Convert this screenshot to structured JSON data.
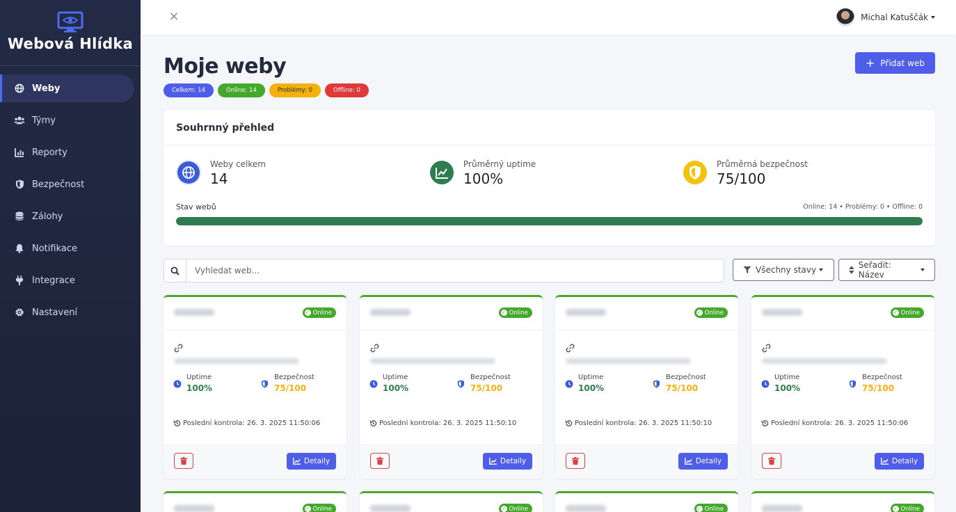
{
  "brand": {
    "name": "Webová Hlídka",
    "icon": "monitor-eye-icon"
  },
  "sidebar": {
    "items": [
      {
        "label": "Weby",
        "icon": "globe-icon",
        "active": true
      },
      {
        "label": "Týmy",
        "icon": "users-icon"
      },
      {
        "label": "Reporty",
        "icon": "chart-icon"
      },
      {
        "label": "Bezpečnost",
        "icon": "shield-icon"
      },
      {
        "label": "Zálohy",
        "icon": "database-icon"
      },
      {
        "label": "Notifikace",
        "icon": "bell-icon"
      },
      {
        "label": "Integrace",
        "icon": "plug-icon"
      },
      {
        "label": "Nastavení",
        "icon": "gear-icon"
      }
    ]
  },
  "topbar": {
    "close_icon": "×",
    "user_name": "Michal Katuščák"
  },
  "page": {
    "title": "Moje weby",
    "add_button": "Přidat web",
    "badges": {
      "total": "Celkem: 14",
      "online": "Online: 14",
      "problems": "Problémy: 0",
      "offline": "Offline: 0"
    }
  },
  "summary": {
    "title": "Souhrnný přehled",
    "stats": [
      {
        "label": "Weby celkem",
        "value": "14",
        "icon": "globe-icon",
        "color": "#3d5bd9"
      },
      {
        "label": "Průměrný uptime",
        "value": "100%",
        "icon": "chart-line-icon",
        "color": "#2e7d4f"
      },
      {
        "label": "Průměrná bezpečnost",
        "value": "75/100",
        "icon": "shield-icon",
        "color": "#f3c20c"
      }
    ],
    "status": {
      "label": "Stav webů",
      "meta": "Online: 14 • Problémy: 0 • Offline: 0",
      "online_fraction": 1.0
    }
  },
  "filters": {
    "search_placeholder": "Vyhledat web...",
    "status_filter": "Všechny stavy",
    "sort": "Seřadit: Název"
  },
  "cards": {
    "status_label": "Online",
    "uptime_label": "Uptime",
    "security_label": "Bezpečnost",
    "details_label": "Detaily",
    "items": [
      {
        "uptime": "100%",
        "security": "75/100",
        "last_check": "Poslední kontrola: 26. 3. 2025 11:50:06"
      },
      {
        "uptime": "100%",
        "security": "75/100",
        "last_check": "Poslední kontrola: 26. 3. 2025 11:50:10"
      },
      {
        "uptime": "100%",
        "security": "75/100",
        "last_check": "Poslední kontrola: 26. 3. 2025 11:50:10"
      },
      {
        "uptime": "100%",
        "security": "75/100",
        "last_check": "Poslední kontrola: 26. 3. 2025 11:50:06"
      }
    ]
  },
  "colors": {
    "accent": "#4e5ee8",
    "success": "#43a82b",
    "warning": "#f3b10c",
    "danger": "#de3a3a",
    "uptime": "#2e7d4f"
  }
}
